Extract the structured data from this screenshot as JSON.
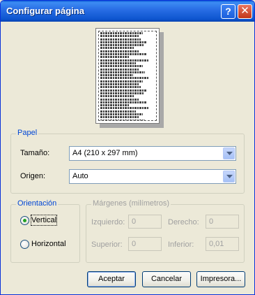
{
  "window": {
    "title": "Configurar página",
    "help_button": "?",
    "close_button": "✕"
  },
  "preview": {
    "lines": 32
  },
  "paper": {
    "legend": "Papel",
    "size_label": "Tamaño:",
    "size_value": "A4 (210 x 297 mm)",
    "source_label": "Origen:",
    "source_value": "Auto"
  },
  "orientation": {
    "legend": "Orientación",
    "portrait_label": "Vertical",
    "landscape_label": "Horizontal",
    "selected": "Vertical"
  },
  "margins": {
    "legend": "Márgenes (milímetros)",
    "left_label": "Izquierdo:",
    "left_value": "0",
    "right_label": "Derecho:",
    "right_value": "0",
    "top_label": "Superior:",
    "top_value": "0",
    "bottom_label": "Inferior:",
    "bottom_value": "0,01"
  },
  "buttons": {
    "ok": "Aceptar",
    "cancel": "Cancelar",
    "printer": "Impresora..."
  },
  "colors": {
    "titlebar": "#0a5bd6",
    "dialog_bg": "#ece9d8",
    "group_legend": "#0046d5",
    "radio_selected": "#21a121"
  }
}
